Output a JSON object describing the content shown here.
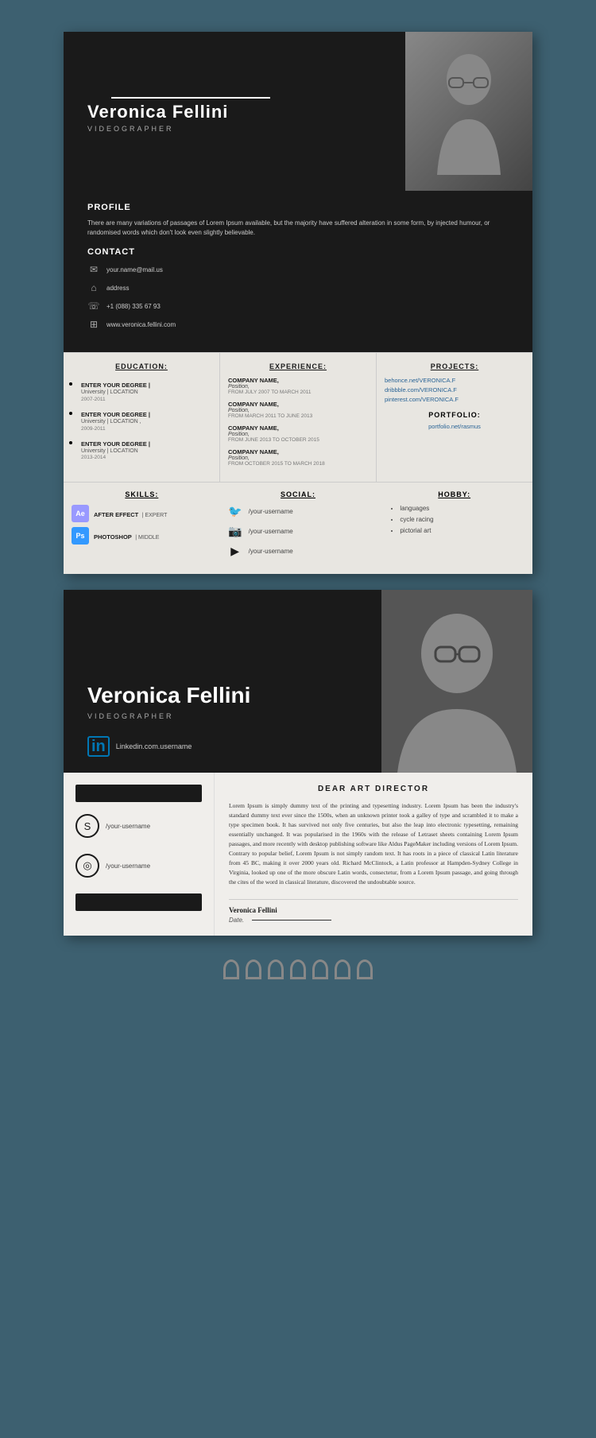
{
  "card1": {
    "name": "Veronica Fellini",
    "title": "VIDEOGRAPHER",
    "white_line": true,
    "profile": {
      "heading": "PROFILE",
      "text": "There are many variations of passages of Lorem Ipsum available, but the majority have suffered alteration in some form, by injected humour, or randomised words which don't look even slightly believable."
    },
    "contact": {
      "heading": "CONTACT",
      "items": [
        {
          "icon": "✉",
          "text": "your.name@mail.us"
        },
        {
          "icon": "⌂",
          "text": "address"
        },
        {
          "icon": "☏",
          "text": "+1 (088) 335 67 93"
        },
        {
          "icon": "⊞",
          "text": "www.veronica.fellini.com"
        }
      ]
    },
    "education": {
      "heading": "EDUCATION:",
      "items": [
        {
          "degree": "ENTER YOUR DEGREE |",
          "sub": "University | LOCATION",
          "date": "2007-2011"
        },
        {
          "degree": "ENTER YOUR DEGREE |",
          "sub": "University | LOCATION ,",
          "date": "2009-2011"
        },
        {
          "degree": "ENTER YOUR DEGREE |",
          "sub": "University | LOCATION",
          "date": "2013-2014"
        }
      ]
    },
    "experience": {
      "heading": "EXPERIENCE:",
      "items": [
        {
          "company": "COMPANY NAME,",
          "position": "Position,",
          "date": "FROM JULY 2007 TO MARCH 2011"
        },
        {
          "company": "COMPANY NAME,",
          "position": "Position,",
          "date": "FROM MARCH 2011 TO JUNE 2013"
        },
        {
          "company": "COMPANY NAME,",
          "position": "Position,",
          "date": "FROM JUNE 2013 TO OCTOBER 2015"
        },
        {
          "company": "COMPANY NAME,",
          "position": "Position,",
          "date": "FROM OCTOBER 2015 TO MARCH 2018"
        }
      ]
    },
    "projects": {
      "heading": "PROJECTS:",
      "links": [
        "behonce.net/VERONICA.F",
        "dribbble.com/VERONICA.F",
        "pinterest.com/VERONICA.F"
      ],
      "portfolio": {
        "heading": "PORTFOLIO:",
        "link": "portfolio.net/rasmus"
      }
    },
    "skills": {
      "heading": "SKILLS:",
      "items": [
        {
          "badge": "Ae",
          "badge_class": "badge-ae",
          "label": "AFTER EFFECT",
          "level": "| EXPERT"
        },
        {
          "badge": "Ps",
          "badge_class": "badge-ps",
          "label": "PHOTOSHOP",
          "level": "| MIDDLE"
        }
      ]
    },
    "social": {
      "heading": "SOCIAL:",
      "items": [
        {
          "icon": "🐦",
          "username": "/your-username"
        },
        {
          "icon": "📷",
          "username": "/your-username"
        },
        {
          "icon": "▶",
          "username": "/your-username"
        }
      ]
    },
    "hobby": {
      "heading": "HOBBY:",
      "items": [
        "languages",
        "cycle racing",
        "pictorial art"
      ]
    }
  },
  "card2": {
    "name": "Veronica Fellini",
    "title": "VIDEOGRAPHER",
    "linkedin": {
      "icon": "in",
      "text": "Linkedin.com.username"
    },
    "left_panel": {
      "social_items": [
        {
          "icon": "S",
          "text": "/your-username"
        },
        {
          "icon": "◎",
          "text": "/your-username"
        }
      ]
    },
    "cover_letter": {
      "dear": "DEAR ART DIRECTOR",
      "text": "Lorem Ipsum is simply dummy text of the printing and typesetting industry. Lorem Ipsum has been the industry's standard dummy text ever since the 1500s, when an unknown printer took a galley of type and scrambled it to make a type specimen book. It has survived not only five centuries, but also the leap into electronic typesetting, remaining essentially unchanged. It was popularised in the 1960s with the release of Letraset sheets containing Lorem Ipsum passages, and more recently with desktop publishing software like Aldus PageMaker including versions of Lorem Ipsum. Contrary to popular belief, Lorem Ipsum is not simply random text. It has roots in a piece of classical Latin literature from 45 BC, making it over 2000 years old. Richard McClintock, a Latin professor at Hampden-Sydney College in Virginia, looked up one of the more obscure Latin words, consectetur, from a Lorem Ipsum passage, and going through the cites of the word in classical literature, discovered the undoubtable source.",
      "signature_name": "Veronica Fellini",
      "date_label": "Date."
    }
  }
}
